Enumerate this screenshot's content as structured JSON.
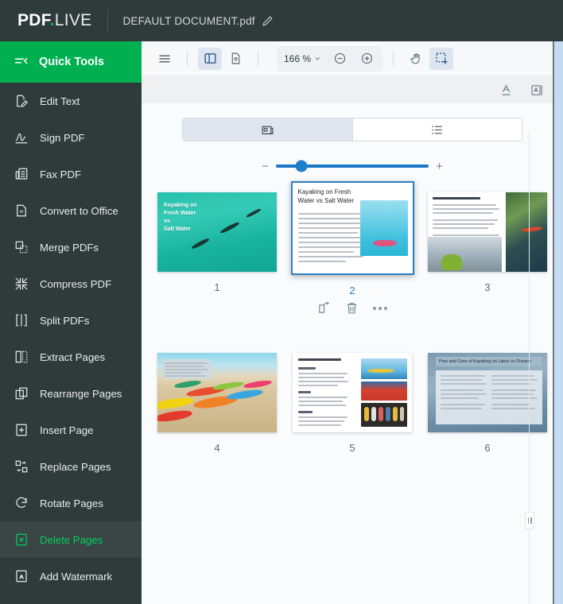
{
  "topbar": {
    "logo_bold": "PDF",
    "logo_dot": ".",
    "logo_light": "LIVE",
    "document_title": "DEFAULT DOCUMENT.pdf",
    "edit_icon": "pencil-icon"
  },
  "sidebar": {
    "header": {
      "label": "Quick Tools",
      "icon": "collapse-menu-icon"
    },
    "items": [
      {
        "label": "Edit Text",
        "icon": "edit-text-icon",
        "active": false
      },
      {
        "label": "Sign PDF",
        "icon": "signature-icon",
        "active": false
      },
      {
        "label": "Fax PDF",
        "icon": "fax-icon",
        "active": false
      },
      {
        "label": "Convert to Office",
        "icon": "word-document-icon",
        "active": false
      },
      {
        "label": "Merge PDFs",
        "icon": "merge-icon",
        "active": false
      },
      {
        "label": "Compress PDF",
        "icon": "compress-icon",
        "active": false
      },
      {
        "label": "Split PDFs",
        "icon": "split-icon",
        "active": false
      },
      {
        "label": "Extract Pages",
        "icon": "extract-pages-icon",
        "active": false
      },
      {
        "label": "Rearrange Pages",
        "icon": "rearrange-pages-icon",
        "active": false
      },
      {
        "label": "Insert Page",
        "icon": "insert-page-icon",
        "active": false
      },
      {
        "label": "Replace Pages",
        "icon": "replace-pages-icon",
        "active": false
      },
      {
        "label": "Rotate Pages",
        "icon": "rotate-pages-icon",
        "active": false
      },
      {
        "label": "Delete Pages",
        "icon": "delete-pages-icon",
        "active": true
      },
      {
        "label": "Add Watermark",
        "icon": "watermark-icon",
        "active": false
      }
    ],
    "active_color": "#00d060",
    "header_color": "#00b050"
  },
  "toolbar": {
    "menu_icon": "hamburger-menu-icon",
    "sidebar_toggle_icon": "panel-layout-icon",
    "page_settings_icon": "document-settings-icon",
    "zoom_level": "166 %",
    "zoom_caret_icon": "chevron-down-icon",
    "zoom_out_icon": "zoom-out-icon",
    "zoom_in_icon": "zoom-in-icon",
    "pan_icon": "hand-pan-icon",
    "select_area_icon": "select-area-icon",
    "text_underline_icon": "text-underline-icon",
    "text_box_icon": "text-box-icon"
  },
  "view_controls": {
    "grid_view_icon": "grid-view-icon",
    "list_view_icon": "list-view-icon",
    "grid_selected": true,
    "slider": {
      "minus_label": "−",
      "plus_label": "+",
      "value_percent": 17,
      "track_color": "#1976c5"
    }
  },
  "pages": [
    {
      "number": "1",
      "selected": false,
      "title": "Kayaking on Fresh Water vs Salt Water",
      "cover_lines": [
        "Kayaking on",
        "Fresh Water",
        "vs",
        "Salt Water"
      ],
      "kind": "cover"
    },
    {
      "number": "2",
      "selected": true,
      "title": "Kayaking on Fresh Water vs Salt Water",
      "kind": "intro"
    },
    {
      "number": "3",
      "selected": false,
      "title": "Fresh Water Kayaking Equipment",
      "kind": "equipment-fresh"
    },
    {
      "number": "4",
      "selected": false,
      "title": "Kayaks on the beach",
      "kind": "beach"
    },
    {
      "number": "5",
      "selected": false,
      "title": "Ocean Kayaking Equipment",
      "kind": "equipment-ocean"
    },
    {
      "number": "6",
      "selected": false,
      "title": "Pros and Cons of Kayaking on Lakes vs Oceans",
      "kind": "proscons"
    }
  ],
  "page_actions": {
    "rotate_icon": "rotate-page-icon",
    "delete_icon": "trash-delete-icon",
    "more_icon": "more-options-icon"
  },
  "resize_handle": {
    "icon": "drag-resize-handle"
  },
  "colors": {
    "brand_green": "#00b050",
    "dark_chrome": "#2f3b3a",
    "selection_blue": "#2b7fc4",
    "panel_bg": "#fafbfc"
  }
}
